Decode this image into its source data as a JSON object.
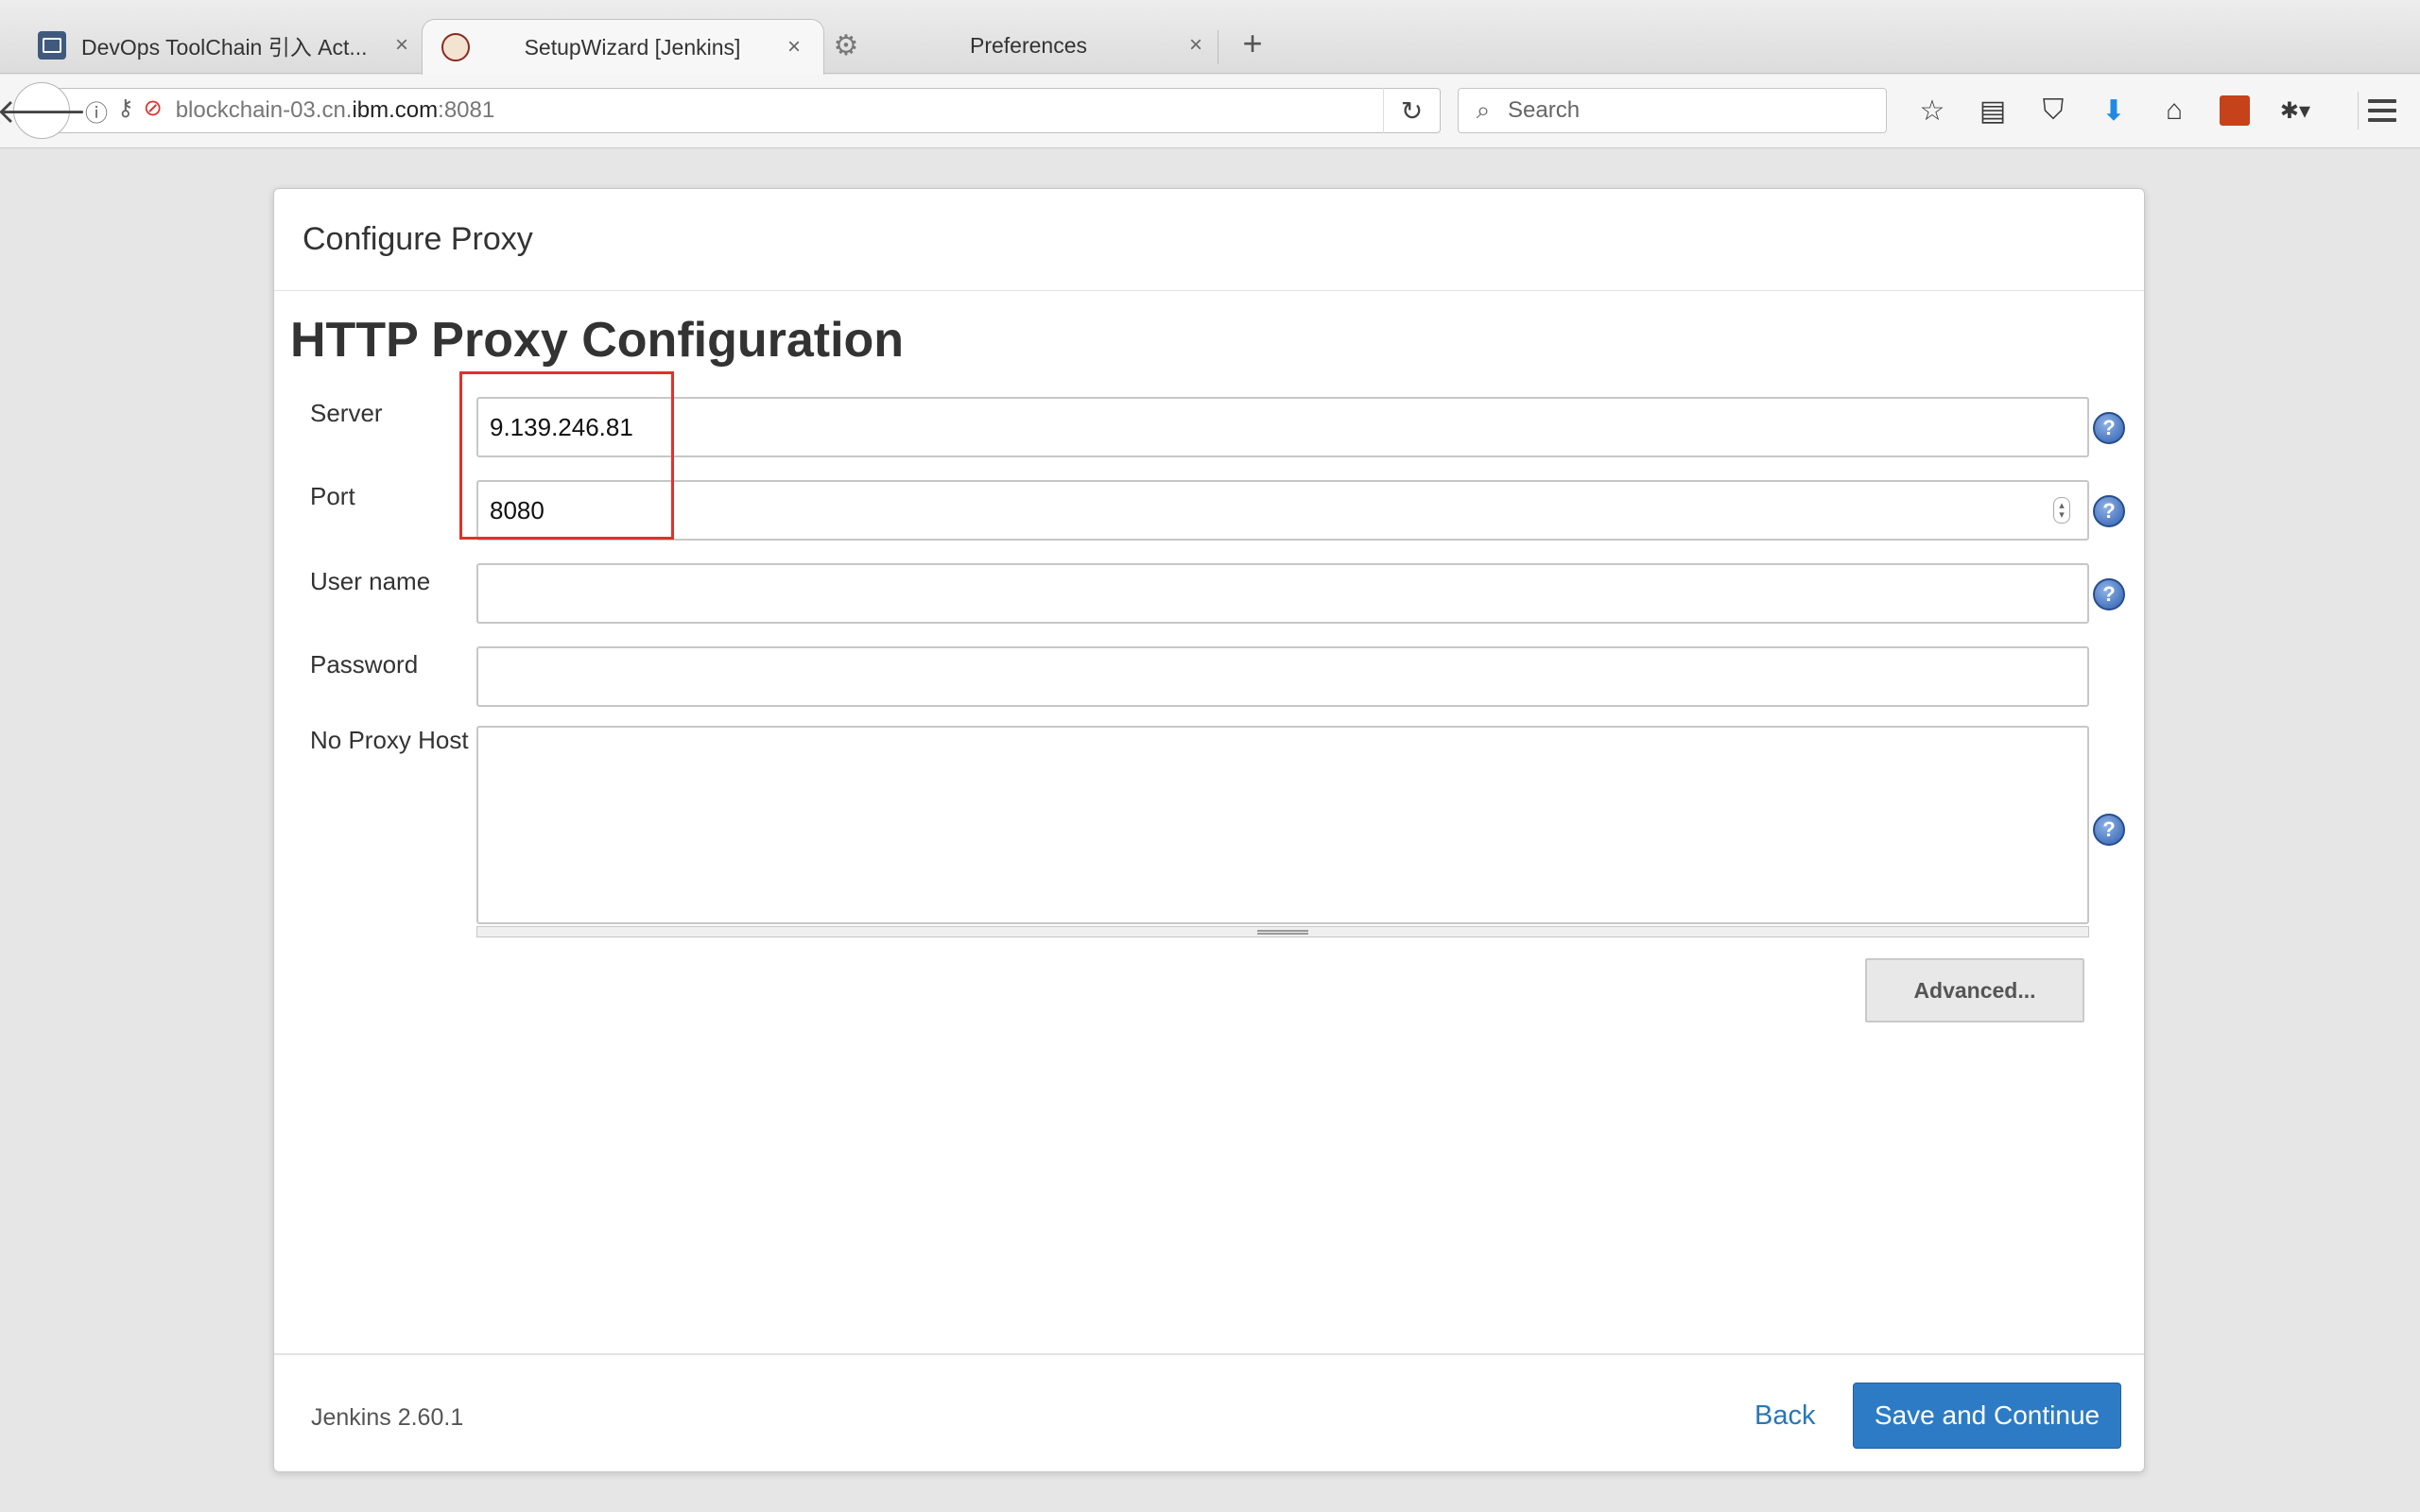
{
  "browser": {
    "tabs": [
      {
        "title": "DevOps ToolChain 引入 Act...",
        "icon": "toolchain-icon"
      },
      {
        "title": "SetupWizard [Jenkins]",
        "icon": "jenkins-icon"
      },
      {
        "title": "Preferences",
        "icon": "gear-icon"
      }
    ],
    "url_prefix": "blockchain-03.cn.",
    "url_domain": "ibm.com",
    "url_suffix": ":8081",
    "search_placeholder": "Search",
    "new_tab_glyph": "+",
    "close_glyph": "×"
  },
  "dialog": {
    "header_title": "Configure Proxy",
    "section_title": "HTTP Proxy Configuration",
    "fields": {
      "server": {
        "label": "Server",
        "value": "9.139.246.81"
      },
      "port": {
        "label": "Port",
        "value": "8080"
      },
      "username": {
        "label": "User name",
        "value": ""
      },
      "password": {
        "label": "Password",
        "value": ""
      },
      "no_proxy_host": {
        "label": "No Proxy Host",
        "value": ""
      }
    },
    "help_glyph": "?",
    "advanced_label": "Advanced..."
  },
  "footer": {
    "version": "Jenkins 2.60.1",
    "back_label": "Back",
    "save_label": "Save and Continue"
  },
  "colors": {
    "primary_button": "#2d7bc4",
    "link": "#2a76b6",
    "highlight_box": "#e0312b",
    "download_icon": "#1f8ae5"
  }
}
